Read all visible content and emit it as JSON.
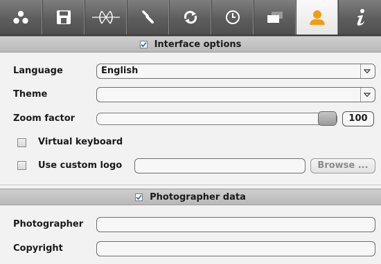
{
  "toolbar": {
    "tabs": [
      {
        "icon": "dots-icon",
        "active": false
      },
      {
        "icon": "save-icon",
        "active": false
      },
      {
        "icon": "lens-icon",
        "active": false
      },
      {
        "icon": "wrench-icon",
        "active": false
      },
      {
        "icon": "refresh-icon",
        "active": false
      },
      {
        "icon": "clock-icon",
        "active": false
      },
      {
        "icon": "windows-icon",
        "active": false
      },
      {
        "icon": "user-icon",
        "active": true
      },
      {
        "icon": "info-icon",
        "active": false
      }
    ],
    "active_color": "#f39c12"
  },
  "interface": {
    "header": "Interface options",
    "header_checked": true,
    "language_label": "Language",
    "language_value": "English",
    "theme_label": "Theme",
    "theme_value": "",
    "zoom_label": "Zoom factor",
    "zoom_value": "100",
    "virtual_keyboard_label": "Virtual keyboard",
    "virtual_keyboard_checked": false,
    "custom_logo_label": "Use custom logo",
    "custom_logo_checked": false,
    "custom_logo_value": "",
    "browse_label": "Browse ..."
  },
  "photographer": {
    "header": "Photographer data",
    "header_checked": true,
    "photographer_label": "Photographer",
    "photographer_value": "",
    "copyright_label": "Copyright",
    "copyright_value": ""
  }
}
